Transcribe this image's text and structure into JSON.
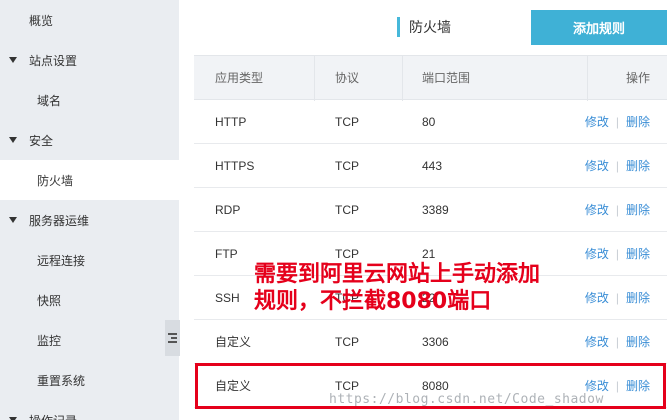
{
  "sidebar": {
    "items": [
      {
        "label": "概览",
        "type": "top"
      },
      {
        "label": "站点设置",
        "type": "group"
      },
      {
        "label": "域名",
        "type": "sub"
      },
      {
        "label": "安全",
        "type": "group"
      },
      {
        "label": "防火墙",
        "type": "sub",
        "active": true
      },
      {
        "label": "服务器运维",
        "type": "group"
      },
      {
        "label": "远程连接",
        "type": "sub"
      },
      {
        "label": "快照",
        "type": "sub"
      },
      {
        "label": "监控",
        "type": "sub"
      },
      {
        "label": "重置系统",
        "type": "sub"
      },
      {
        "label": "操作记录",
        "type": "group"
      }
    ]
  },
  "header": {
    "title": "防火墙",
    "add_button_label": "添加规则"
  },
  "table": {
    "columns": [
      "应用类型",
      "协议",
      "端口范围",
      "操作"
    ],
    "rows": [
      {
        "app": "HTTP",
        "protocol": "TCP",
        "port": "80"
      },
      {
        "app": "HTTPS",
        "protocol": "TCP",
        "port": "443"
      },
      {
        "app": "RDP",
        "protocol": "TCP",
        "port": "3389"
      },
      {
        "app": "FTP",
        "protocol": "TCP",
        "port": "21"
      },
      {
        "app": "SSH",
        "protocol": "TCP",
        "port": "22"
      },
      {
        "app": "自定义",
        "protocol": "TCP",
        "port": "3306"
      },
      {
        "app": "自定义",
        "protocol": "TCP",
        "port": "8080"
      }
    ],
    "edit_label": "修改",
    "op_separator": "|",
    "delete_label": "删除"
  },
  "annotation": {
    "text_line1": "需要到阿里云网站上手动添加",
    "text_line2": "规则，不拦截8080端口",
    "color": "#e5001b"
  },
  "watermark": "https://blog.csdn.net/Code_shadow",
  "colors": {
    "accent": "#3fb1d6",
    "link": "#3a8ed6",
    "sidebar_bg": "#eaedf1"
  }
}
